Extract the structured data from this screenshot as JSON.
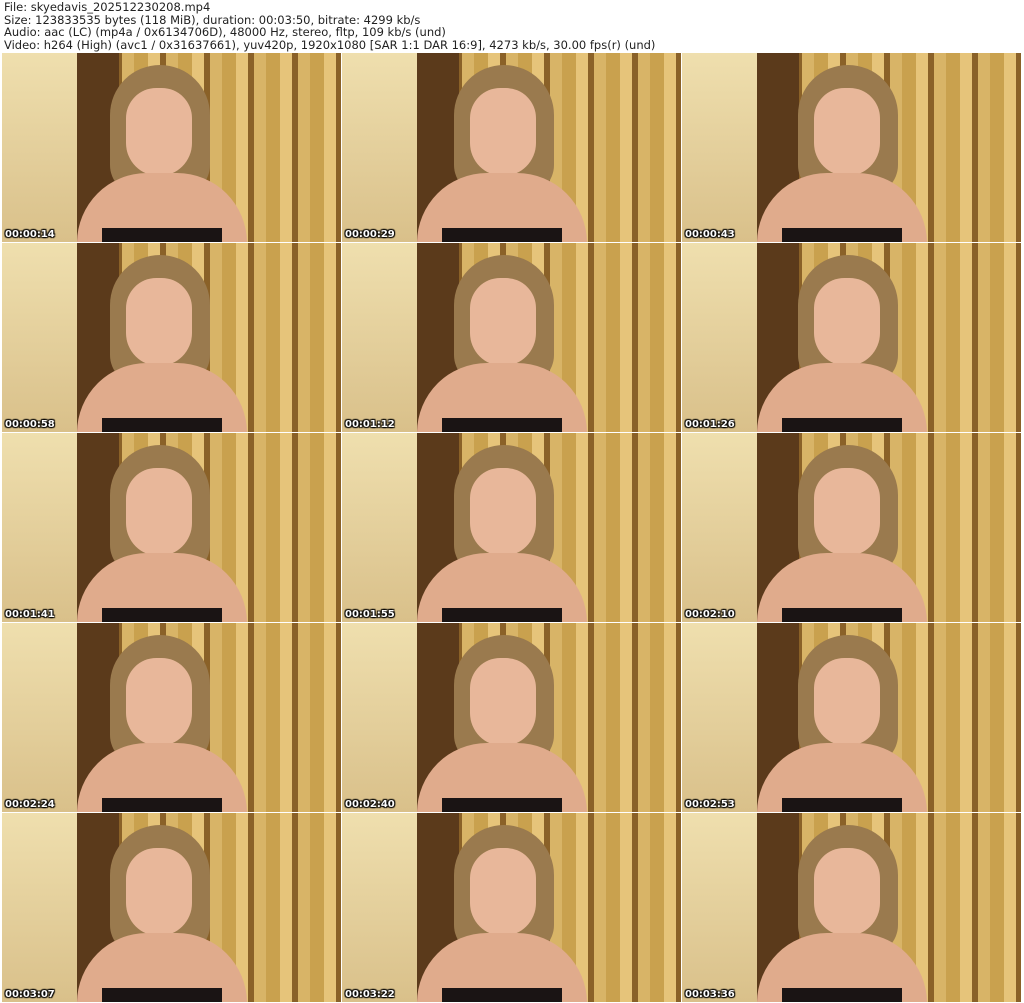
{
  "header": {
    "file": "File: skyedavis_202512230208.mp4",
    "size": "Size: 123833535 bytes (118 MiB), duration: 00:03:50, bitrate: 4299 kb/s",
    "audio": "Audio: aac (LC) (mp4a / 0x6134706D), 48000 Hz, stereo, fltp, 109 kb/s (und)",
    "video": "Video: h264 (High) (avc1 / 0x31637661), yuv420p, 1920x1080 [SAR 1:1 DAR 16:9], 4273 kb/s, 30.00 fps(r) (und)"
  },
  "thumbnails": [
    {
      "timestamp": "00:00:14"
    },
    {
      "timestamp": "00:00:29"
    },
    {
      "timestamp": "00:00:43"
    },
    {
      "timestamp": "00:00:58"
    },
    {
      "timestamp": "00:01:12"
    },
    {
      "timestamp": "00:01:26"
    },
    {
      "timestamp": "00:01:41"
    },
    {
      "timestamp": "00:01:55"
    },
    {
      "timestamp": "00:02:10"
    },
    {
      "timestamp": "00:02:24"
    },
    {
      "timestamp": "00:02:40"
    },
    {
      "timestamp": "00:02:53"
    },
    {
      "timestamp": "00:03:07"
    },
    {
      "timestamp": "00:03:22"
    },
    {
      "timestamp": "00:03:36"
    }
  ]
}
